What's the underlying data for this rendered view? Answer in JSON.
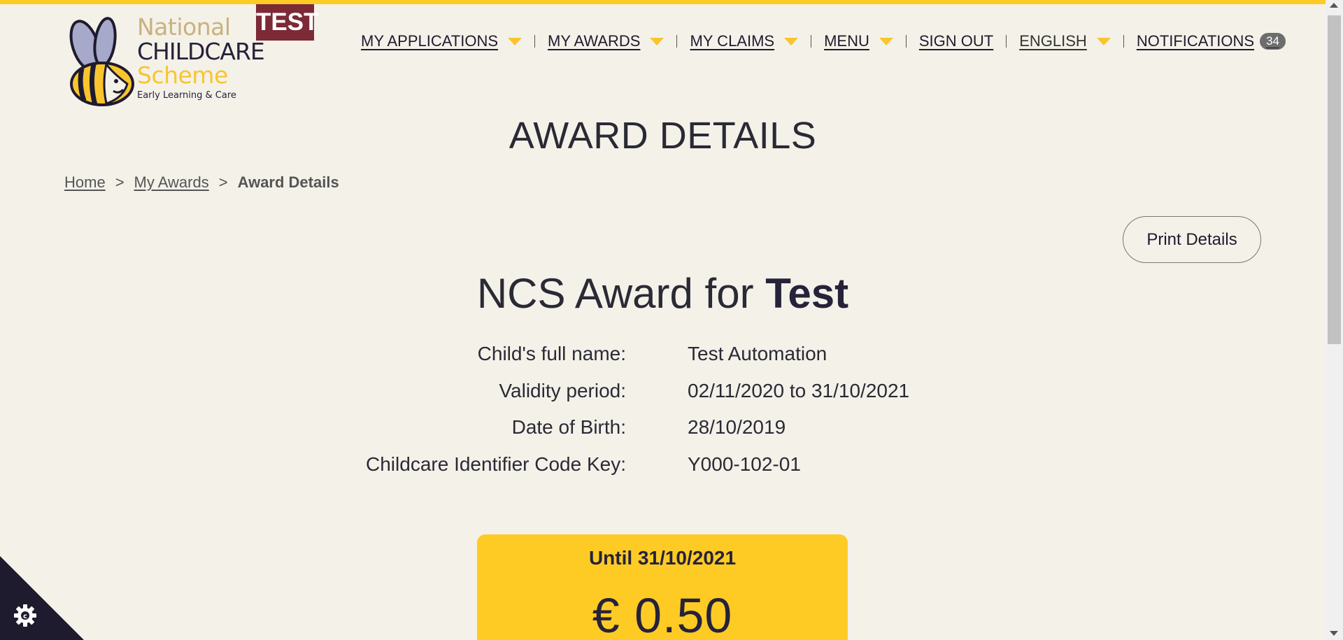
{
  "colors": {
    "accent": "#fdcb24",
    "dark": "#1f1b2e",
    "test_badge": "#7c2a35",
    "background": "#f4f1e9"
  },
  "logo": {
    "line1": "National",
    "line2": "CHILDCARE",
    "line3": "Scheme",
    "tagline": "Early Learning & Care",
    "icon": "bee-logo-icon"
  },
  "env_badge": "TEST",
  "nav": {
    "items": [
      {
        "label": "MY APPLICATIONS",
        "dropdown": true
      },
      {
        "label": "MY AWARDS",
        "dropdown": true
      },
      {
        "label": "MY CLAIMS",
        "dropdown": true
      },
      {
        "label": "MENU",
        "dropdown": true
      },
      {
        "label": "SIGN OUT",
        "dropdown": false
      },
      {
        "label": "ENGLISH",
        "dropdown": true
      },
      {
        "label": "NOTIFICATIONS",
        "dropdown": false
      }
    ],
    "notifications_count": "34"
  },
  "page_title": "AWARD DETAILS",
  "breadcrumb": {
    "home": "Home",
    "my_awards": "My Awards",
    "current": "Award Details",
    "separator": ">"
  },
  "print_button": "Print Details",
  "award": {
    "heading_prefix": "NCS Award for",
    "heading_name": "Test",
    "details": [
      {
        "label": "Child's full name:",
        "value": "Test Automation"
      },
      {
        "label": "Validity period:",
        "value": "02/11/2020 to 31/10/2021"
      },
      {
        "label": "Date of Birth:",
        "value": "28/10/2019"
      },
      {
        "label": "Childcare Identifier Code Key:",
        "value": "Y000-102-01"
      }
    ]
  },
  "amount_card": {
    "until": "Until 31/10/2021",
    "amount": "€ 0.50"
  },
  "cookie_icon": "cookie-settings-gear-icon"
}
